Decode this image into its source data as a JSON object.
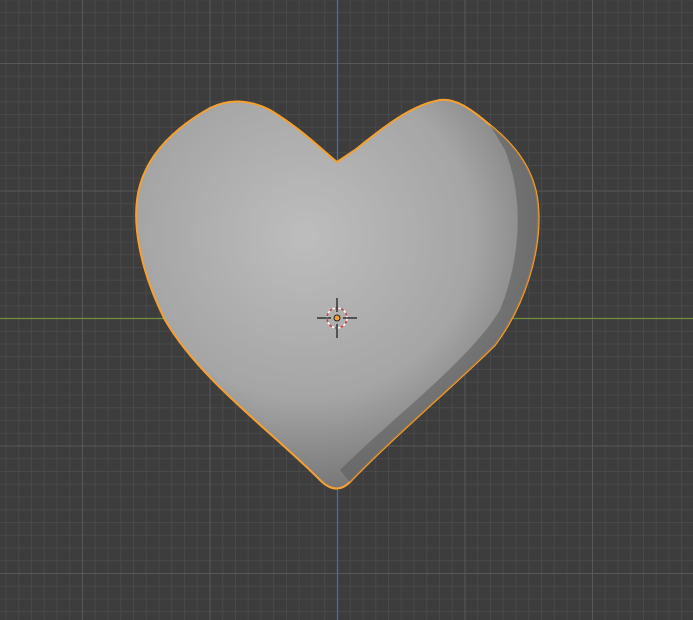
{
  "viewport": {
    "object": "heart-mesh",
    "selected": true,
    "colors": {
      "background": "#3d3d3d",
      "x_axis": "#6f8f3a",
      "y_axis": "#3f6fb0",
      "selection_outline": "#f5a030",
      "mesh": "#a8a8a8",
      "origin": "#f5a030"
    }
  }
}
